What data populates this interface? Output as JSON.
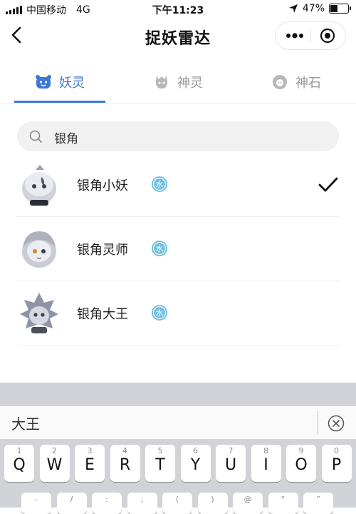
{
  "status_bar": {
    "carrier": "中国移动",
    "network": "4G",
    "time": "下午11:23",
    "battery": "47%",
    "battery_level": 0.47
  },
  "nav": {
    "title": "捉妖雷达"
  },
  "tabs": [
    {
      "label": "妖灵",
      "icon": "yaoling-icon",
      "active": true
    },
    {
      "label": "神灵",
      "icon": "shenling-icon",
      "active": false
    },
    {
      "label": "神石",
      "icon": "shenshi-icon",
      "active": false
    }
  ],
  "search": {
    "value": "银角"
  },
  "results": [
    {
      "name": "银角小妖",
      "element": "水",
      "selected": true
    },
    {
      "name": "银角灵师",
      "element": "水",
      "selected": false
    },
    {
      "name": "银角大王",
      "element": "水",
      "selected": false
    }
  ],
  "keyboard": {
    "input_text": "大王",
    "row1": [
      {
        "main": "Q",
        "sub": "1"
      },
      {
        "main": "W",
        "sub": "2"
      },
      {
        "main": "E",
        "sub": "3"
      },
      {
        "main": "R",
        "sub": "4"
      },
      {
        "main": "T",
        "sub": "5"
      },
      {
        "main": "Y",
        "sub": "6"
      },
      {
        "main": "U",
        "sub": "7"
      },
      {
        "main": "I",
        "sub": "8"
      },
      {
        "main": "O",
        "sub": "9"
      },
      {
        "main": "P",
        "sub": "0"
      }
    ],
    "row2": [
      "-",
      "/",
      ":",
      ";",
      "(",
      ")",
      "@",
      "“",
      "”"
    ]
  },
  "colors": {
    "accent": "#3b78d8",
    "water_badge": "#6fbfe0"
  }
}
